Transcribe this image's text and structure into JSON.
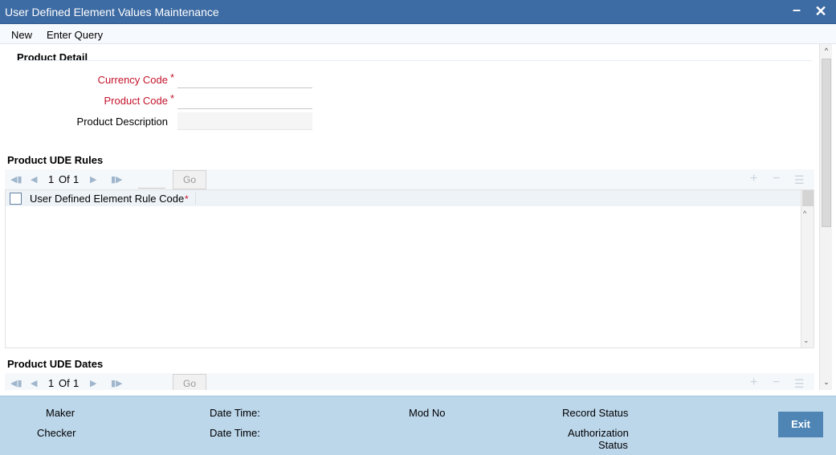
{
  "window": {
    "title": "User Defined Element Values Maintenance",
    "minimize_icon": "minimize-icon",
    "close_icon": "close-icon"
  },
  "menu": {
    "new_label": "New",
    "enter_query_label": "Enter Query"
  },
  "product_detail": {
    "heading": "Product Detail",
    "currency_code": {
      "label": "Currency Code",
      "required": "*",
      "value": ""
    },
    "product_code": {
      "label": "Product Code",
      "required": "*",
      "value": ""
    },
    "product_description": {
      "label": "Product Description",
      "value": ""
    }
  },
  "ude_rules": {
    "heading": "Product UDE Rules",
    "pagination": {
      "current": "1",
      "of_label": "Of",
      "total": "1",
      "go_label": "Go"
    },
    "columns": [
      {
        "label": "User Defined Element Rule Code",
        "required": "*"
      }
    ],
    "rows": []
  },
  "ude_dates": {
    "heading": "Product UDE Dates",
    "pagination": {
      "current": "1",
      "of_label": "Of",
      "total": "1",
      "go_label": "Go"
    }
  },
  "footer": {
    "maker_label": "Maker",
    "checker_label": "Checker",
    "date_time_label": "Date Time:",
    "date_time_label_2": "Date Time:",
    "mod_no_label": "Mod No",
    "record_status_label": "Record Status",
    "authorization_label": "Authorization",
    "status_label": "Status",
    "exit_label": "Exit"
  },
  "colors": {
    "titlebar": "#3d6ba3",
    "footer": "#bcd6ea",
    "required": "#c3132b",
    "exit_button": "#4e85b5"
  }
}
